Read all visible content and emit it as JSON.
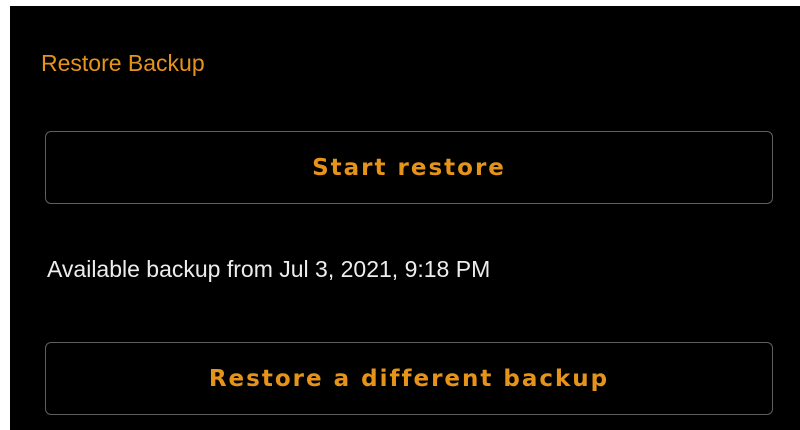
{
  "section": {
    "title": "Restore Backup"
  },
  "actions": {
    "start_restore_label": "Start restore",
    "restore_different_label": "Restore a different backup"
  },
  "backup": {
    "available_text": "Available backup from Jul 3, 2021, 9:18 PM"
  },
  "colors": {
    "accent": "#e69419",
    "background": "#000000",
    "text": "#ededed",
    "button_border": "#5f5f5f"
  }
}
